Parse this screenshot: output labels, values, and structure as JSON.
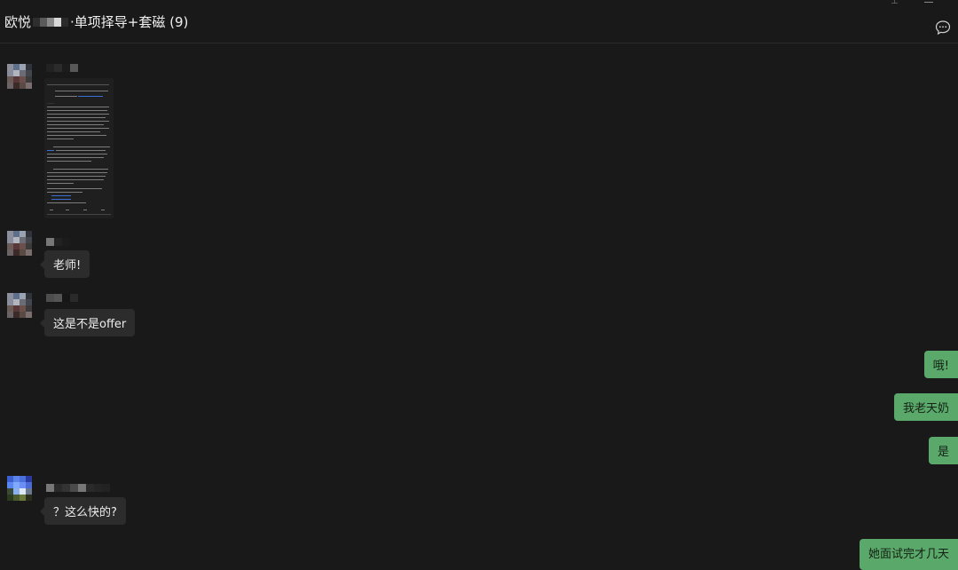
{
  "header": {
    "title_prefix": "欧悦",
    "title_suffix": "·单项择导+套磁 (9)",
    "more_icon": "chat-bubble-more-icon"
  },
  "messages": [
    {
      "side": "in",
      "type": "image",
      "content": "document-screenshot"
    },
    {
      "side": "in",
      "type": "text",
      "text": "老师!"
    },
    {
      "side": "in",
      "type": "text",
      "text": "这是不是offer"
    },
    {
      "side": "out",
      "type": "text",
      "text": "哦!"
    },
    {
      "side": "out",
      "type": "text",
      "text": "我老天奶"
    },
    {
      "side": "out",
      "type": "text",
      "text": "是"
    },
    {
      "side": "in",
      "type": "text",
      "text": "？这么快的?"
    },
    {
      "side": "out",
      "type": "text",
      "text": "她面试完才几天"
    }
  ],
  "colors": {
    "background": "#191919",
    "bubble_in": "#2c2c2c",
    "bubble_out": "#5aa96a"
  }
}
